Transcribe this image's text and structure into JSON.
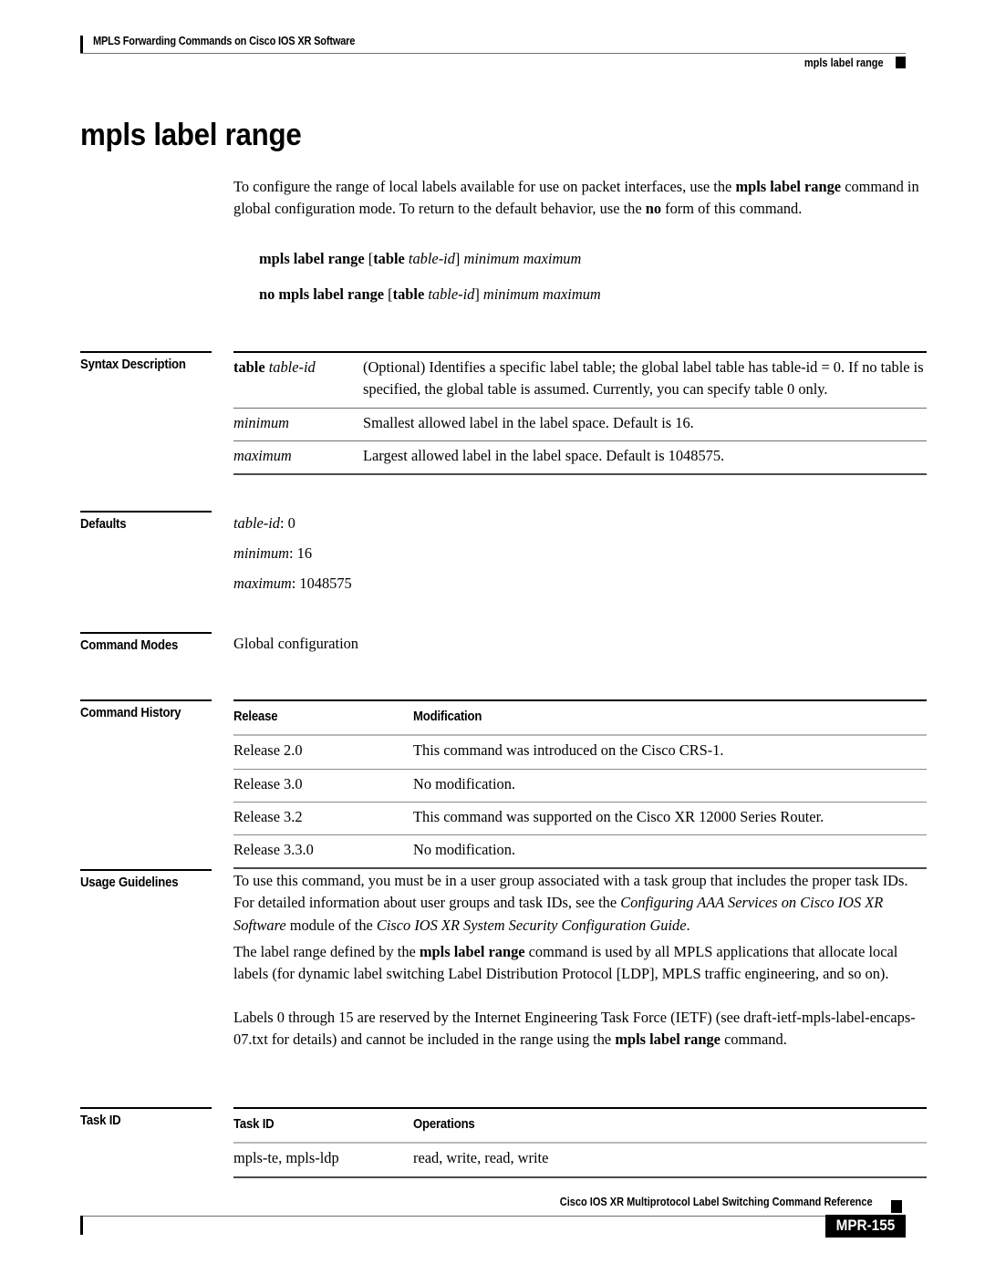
{
  "header": {
    "left_title": "MPLS Forwarding Commands on Cisco IOS XR Software",
    "right_title": "mpls label range"
  },
  "command": {
    "title": "mpls label range",
    "intro": {
      "p1_a": "To configure the range of local labels available for use on packet interfaces, use the ",
      "p1_bold1": "mpls label range",
      "p1_b": " command in global configuration mode. To return to the default behavior, use the ",
      "p1_bold2": "no",
      "p1_c": " form of this command."
    },
    "syntax": {
      "line1_bold1": "mpls label range",
      "line1_bracket_open": " [",
      "line1_bold2": "table",
      "line1_italic1": " table-id",
      "line1_bracket_close": "]",
      "line1_italic2": " minimum maximum",
      "line2_bold1": "no mpls label range",
      "line2_bracket_open": " [",
      "line2_bold2": "table",
      "line2_italic1": " table-id",
      "line2_bracket_close": "]",
      "line2_italic2": " minimum maximum"
    }
  },
  "sections": {
    "syntax_description": {
      "label": "Syntax Description",
      "rows": [
        {
          "term_bold": "table",
          "term_italic": " table-id",
          "description": "(Optional) Identifies a specific label table; the global label table has table-id = 0. If no table is specified, the global table is assumed. Currently, you can specify table 0 only."
        },
        {
          "term_bold": "",
          "term_italic": "minimum",
          "description": "Smallest allowed label in the label space. Default is 16."
        },
        {
          "term_bold": "",
          "term_italic": "maximum",
          "description": "Largest allowed label in the label space. Default is 1048575."
        }
      ]
    },
    "defaults": {
      "label": "Defaults",
      "lines": [
        {
          "term": "table-id",
          "value": ": 0"
        },
        {
          "term": "minimum",
          "value": ": 16"
        },
        {
          "term": "maximum",
          "value": ": 1048575"
        }
      ]
    },
    "command_modes": {
      "label": "Command Modes",
      "value": "Global configuration"
    },
    "command_history": {
      "label": "Command History",
      "columns": [
        "Release",
        "Modification"
      ],
      "rows": [
        [
          "Release 2.0",
          "This command was introduced on the Cisco CRS-1."
        ],
        [
          "Release 3.0",
          "No modification."
        ],
        [
          "Release 3.2",
          "This command was supported on the Cisco XR 12000 Series Router."
        ],
        [
          "Release 3.3.0",
          "No modification."
        ]
      ]
    },
    "usage_guidelines": {
      "label": "Usage Guidelines",
      "p1_a": "To use this command, you must be in a user group associated with a task group that includes the proper task IDs. For detailed information about user groups and task IDs, see the ",
      "p1_italic1": "Configuring AAA Services on Cisco IOS XR Software",
      "p1_b": " module of the ",
      "p1_italic2": "Cisco IOS XR System Security Configuration Guide",
      "p1_c": ".",
      "p2_a": "The label range defined by the ",
      "p2_bold1": "mpls label range",
      "p2_b": " command is used by all MPLS applications that allocate local labels (for dynamic label switching Label Distribution Protocol [LDP], MPLS traffic engineering, and so on).",
      "p3_a": "Labels 0 through 15 are reserved by the Internet Engineering Task Force (IETF) (see draft-ietf-mpls-label-encaps-07.txt for details) and cannot be included in the range using the ",
      "p3_bold1": "mpls label range",
      "p3_b": " command."
    },
    "task_id": {
      "label": "Task ID",
      "columns": [
        "Task ID",
        "Operations"
      ],
      "rows": [
        [
          "mpls-te, mpls-ldp",
          "read, write, read, write"
        ]
      ]
    }
  },
  "footer": {
    "text": "Cisco IOS XR Multiprotocol Label Switching Command Reference",
    "page_number": "MPR-155"
  }
}
